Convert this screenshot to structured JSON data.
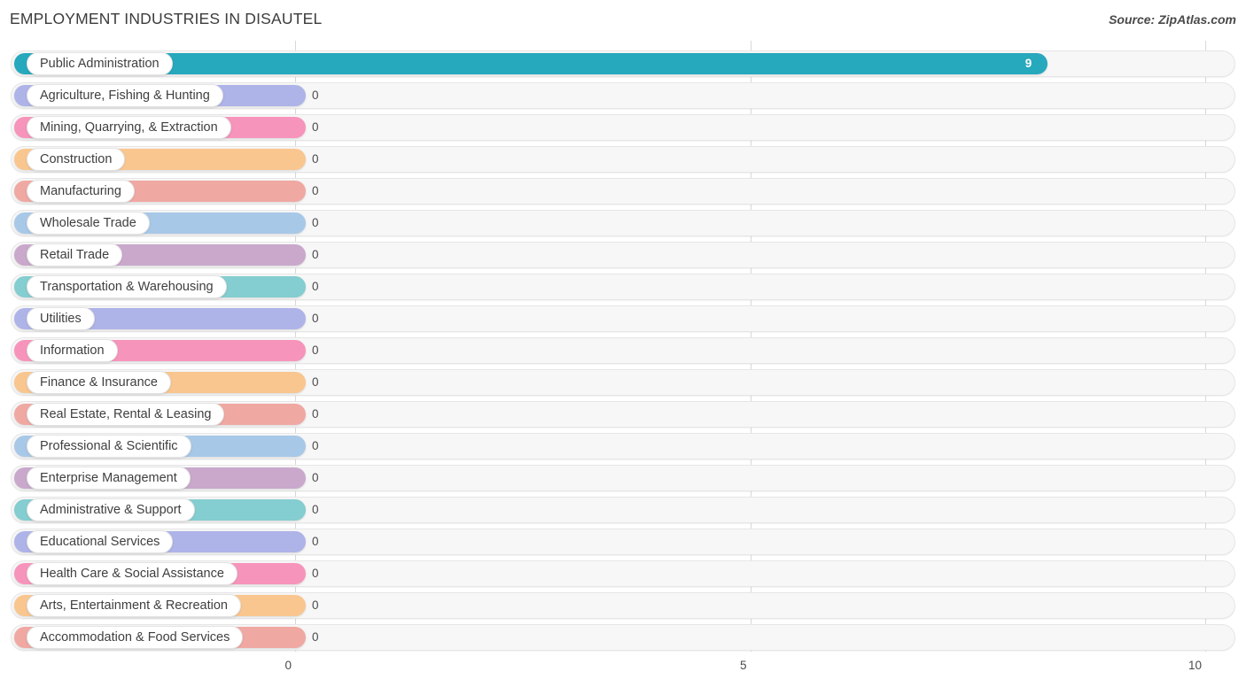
{
  "header": {
    "title": "EMPLOYMENT INDUSTRIES IN DISAUTEL",
    "source": "Source: ZipAtlas.com"
  },
  "chart_data": {
    "type": "bar",
    "orientation": "horizontal",
    "title": "EMPLOYMENT INDUSTRIES IN DISAUTEL",
    "xlabel": "",
    "ylabel": "",
    "xlim": [
      0,
      10
    ],
    "ticks": [
      {
        "label": "0",
        "value": 0
      },
      {
        "label": "5",
        "value": 5
      },
      {
        "label": "10",
        "value": 10
      }
    ],
    "grid": true,
    "legend": "none",
    "categories": [
      "Public Administration",
      "Agriculture, Fishing & Hunting",
      "Mining, Quarrying, & Extraction",
      "Construction",
      "Manufacturing",
      "Wholesale Trade",
      "Retail Trade",
      "Transportation & Warehousing",
      "Utilities",
      "Information",
      "Finance & Insurance",
      "Real Estate, Rental & Leasing",
      "Professional & Scientific",
      "Enterprise Management",
      "Administrative & Support",
      "Educational Services",
      "Health Care & Social Assistance",
      "Arts, Entertainment & Recreation",
      "Accommodation & Food Services"
    ],
    "values": [
      9,
      0,
      0,
      0,
      0,
      0,
      0,
      0,
      0,
      0,
      0,
      0,
      0,
      0,
      0,
      0,
      0,
      0,
      0
    ],
    "value_labels": [
      "9",
      "0",
      "0",
      "0",
      "0",
      "0",
      "0",
      "0",
      "0",
      "0",
      "0",
      "0",
      "0",
      "0",
      "0",
      "0",
      "0",
      "0",
      "0"
    ],
    "colors": [
      "#26a8bd",
      "#aeb3e8",
      "#f794bb",
      "#f9c68f",
      "#f0a8a2",
      "#a8c8e8",
      "#c9a8cc",
      "#84cdd0",
      "#aeb3e8",
      "#f794bb",
      "#f9c68f",
      "#f0a8a2",
      "#a8c8e8",
      "#c9a8cc",
      "#84cdd0",
      "#aeb3e8",
      "#f794bb",
      "#f9c68f",
      "#f0a8a2"
    ]
  }
}
